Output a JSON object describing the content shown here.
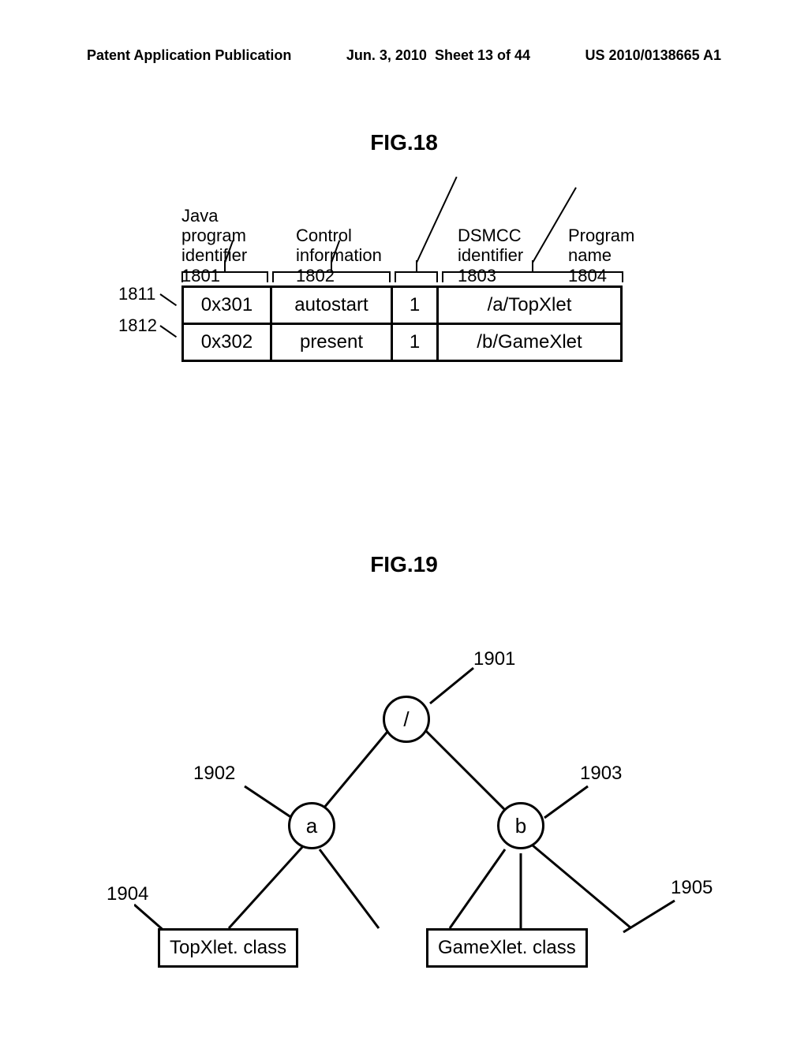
{
  "header": {
    "pub_type": "Patent Application Publication",
    "date": "Jun. 3, 2010",
    "sheet": "Sheet 13 of 44",
    "pub_id": "US 2010/0138665 A1"
  },
  "fig18": {
    "title": "FIG.18",
    "columns": {
      "java_prog_id": {
        "label": "Java\nprogram\nidentifier",
        "ref": "1801"
      },
      "control_info": {
        "label": "Control\ninformation",
        "ref": "1802"
      },
      "dsmcc_id": {
        "label": "DSMCC\nidentifier",
        "ref": "1803"
      },
      "prog_name": {
        "label": "Program\nname",
        "ref": "1804"
      }
    },
    "rows": [
      {
        "ref": "1811",
        "java_prog_id": "0x301",
        "control_info": "autostart",
        "dsmcc_id": "1",
        "prog_name": "/a/TopXlet"
      },
      {
        "ref": "1812",
        "java_prog_id": "0x302",
        "control_info": "present",
        "dsmcc_id": "1",
        "prog_name": "/b/GameXlet"
      }
    ]
  },
  "fig19": {
    "title": "FIG.19",
    "nodes": {
      "root": {
        "ref": "1901",
        "label": "/"
      },
      "a": {
        "ref": "1902",
        "label": "a"
      },
      "b": {
        "ref": "1903",
        "label": "b"
      },
      "top": {
        "ref": "1904",
        "label": "TopXlet. class"
      },
      "game": {
        "ref": "1905",
        "label": "GameXlet. class"
      }
    }
  }
}
